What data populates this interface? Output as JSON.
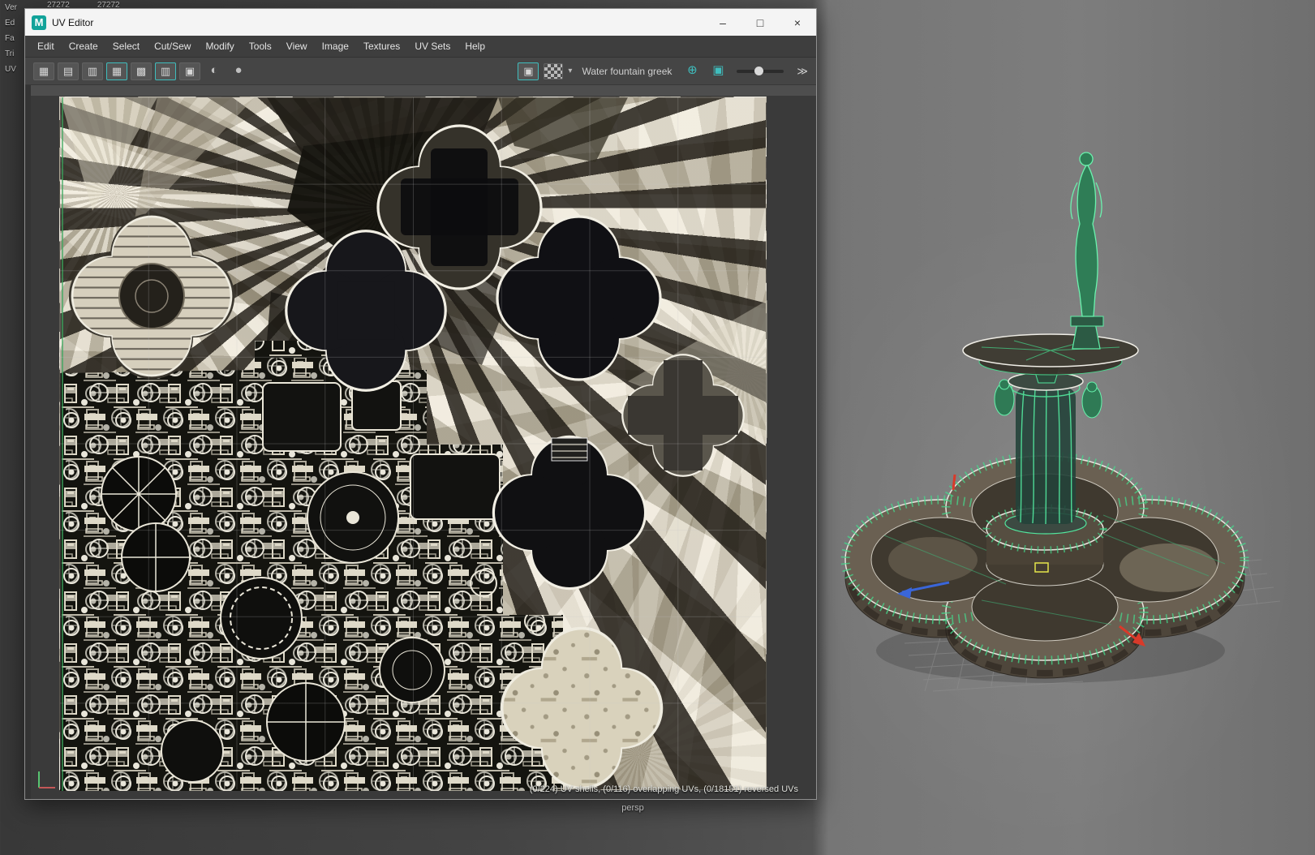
{
  "viewport": {
    "camera_label": "persp",
    "hud": {
      "verts_label": "Ver",
      "verts_value_1": "27272",
      "verts_value_2": "27272",
      "rows": [
        "Ed",
        "Fa",
        "Tri",
        "UV"
      ]
    }
  },
  "window": {
    "title": "UV Editor",
    "logo_letter": "M",
    "controls": {
      "minimize": "–",
      "maximize": "□",
      "close": "×"
    }
  },
  "menu": {
    "items": [
      "Edit",
      "Create",
      "Select",
      "Cut/Sew",
      "Modify",
      "Tools",
      "View",
      "Image",
      "Textures",
      "UV Sets",
      "Help"
    ]
  },
  "toolbar": {
    "texture_label": "Water fountain greek",
    "icons": {
      "tiles": [
        "▦",
        "▤",
        "▥",
        "▦",
        "▩",
        "▥",
        "▣"
      ],
      "dim_shaded": "◐",
      "dim_solid": "●",
      "image_display": "▣",
      "dropdown": "▾",
      "globe": "⊕",
      "swatch": "▣",
      "expand": "≫"
    }
  },
  "canvas": {
    "status_text": "(0/224) UV shells, (0/116) overlapping UVs, (0/18151) reversed UVs"
  },
  "colors": {
    "accent_teal": "#3fbdbd",
    "wireframe_green": "#4ee08f",
    "shell_outline_white": "#f2efe4"
  }
}
